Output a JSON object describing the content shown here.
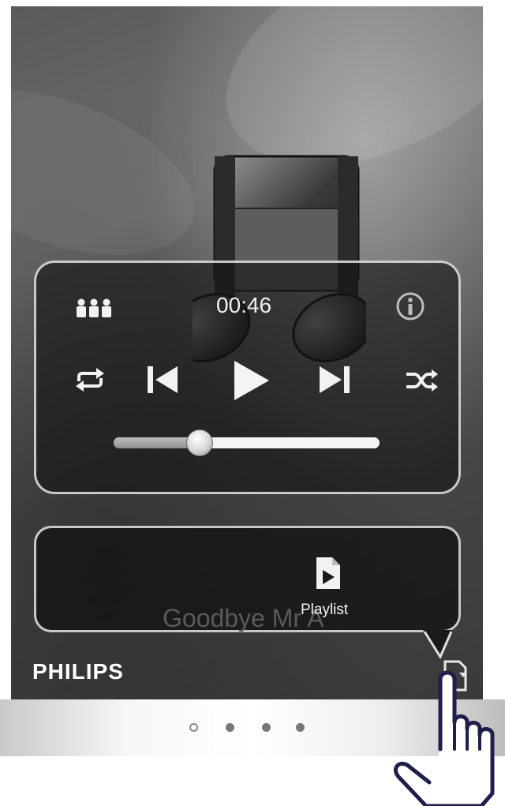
{
  "player": {
    "elapsed_time": "00:46",
    "progress_fraction": 0.32,
    "track_title": "Goodbye Mr A"
  },
  "controls": {
    "library_icon": "artists-icon",
    "info_icon": "info-icon",
    "repeat_icon": "repeat-icon",
    "previous_icon": "previous-track-icon",
    "play_icon": "play-icon",
    "next_icon": "next-track-icon",
    "shuffle_icon": "shuffle-icon"
  },
  "playlist": {
    "label": "Playlist"
  },
  "footer": {
    "brand": "PHILIPS"
  },
  "pager": {
    "page_count": 4,
    "active_index": 0
  },
  "colors": {
    "panel_border": "#e6e6e6",
    "icon": "#f2f2f2",
    "background": "#5a5a5a"
  }
}
